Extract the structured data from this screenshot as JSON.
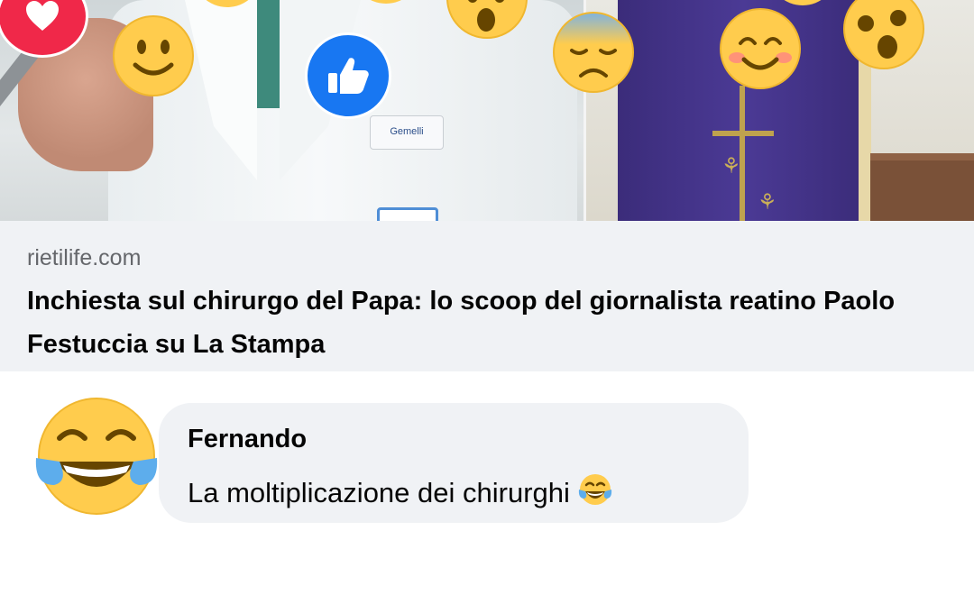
{
  "colors": {
    "link_meta_bg": "#f0f2f5",
    "comment_bubble_bg": "#f0f2f5",
    "secondary_text": "#65676b",
    "primary_text": "#050505",
    "love_red": "#f02849",
    "like_blue": "#1877f2",
    "emoji_yellow": "#ffcc4d"
  },
  "preview": {
    "image_description": "Photo of a surgeon in a white coat holding a microphone beside a purple liturgical vestment",
    "badge_text": "Gemelli",
    "floating_reactions": [
      "love-reaction-icon",
      "slightly-smiling-face-emoji",
      "like-reaction-icon",
      "face-with-open-mouth-emoji",
      "pensive-face-emoji",
      "smiling-face-with-smiling-eyes-emoji",
      "astonished-face-emoji"
    ]
  },
  "link": {
    "domain": "rietilife.com",
    "title": "Inchiesta sul chirurgo del Papa: lo scoop del giornalista reatino Paolo Festuccia su La Stampa"
  },
  "comment": {
    "avatar_icon": "face-with-tears-of-joy-emoji",
    "author": "Fernando",
    "text": "La moltiplicazione dei chirurghi",
    "trailing_emoji": "face-with-tears-of-joy-emoji"
  }
}
